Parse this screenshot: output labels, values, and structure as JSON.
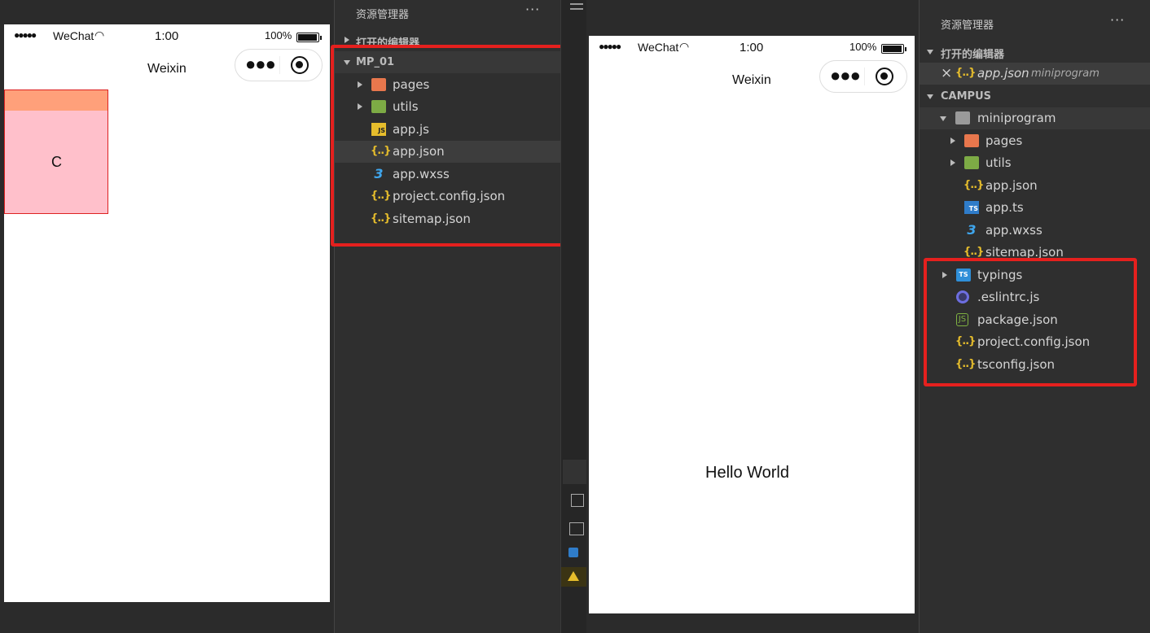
{
  "left_phone": {
    "status": {
      "carrier": "WeChat",
      "time": "1:00",
      "battery": "100%"
    },
    "nav_title": "Weixin",
    "box_text": "C"
  },
  "left_explorer": {
    "title": "资源管理器",
    "more": "···",
    "open_editors": "打开的编辑器",
    "project": "MP_01",
    "items": [
      {
        "label": "pages",
        "icon": "folder-pages-icon"
      },
      {
        "label": "utils",
        "icon": "folder-utils-icon"
      },
      {
        "label": "app.js",
        "icon": "js-file-icon"
      },
      {
        "label": "app.json",
        "icon": "json-file-icon"
      },
      {
        "label": "app.wxss",
        "icon": "css-file-icon"
      },
      {
        "label": "project.config.json",
        "icon": "json-file-icon"
      },
      {
        "label": "sitemap.json",
        "icon": "json-file-icon"
      }
    ],
    "selected": "app.json"
  },
  "right_phone": {
    "status": {
      "carrier": "WeChat",
      "time": "1:00",
      "battery": "100%"
    },
    "nav_title": "Weixin",
    "body_text": "Hello World"
  },
  "right_explorer": {
    "title": "资源管理器",
    "more": "···",
    "open_editors": "打开的编辑器",
    "open_file": {
      "close": "×",
      "name": "app.json",
      "path": "miniprogram"
    },
    "project": "CAMPUS",
    "folder": "miniprogram",
    "folder_items": [
      {
        "label": "pages",
        "icon": "folder-pages-icon"
      },
      {
        "label": "utils",
        "icon": "folder-utils-icon"
      },
      {
        "label": "app.json",
        "icon": "json-file-icon"
      },
      {
        "label": "app.ts",
        "icon": "ts-file-icon"
      },
      {
        "label": "app.wxss",
        "icon": "css-file-icon"
      },
      {
        "label": "sitemap.json",
        "icon": "json-file-icon"
      }
    ],
    "root_items": [
      {
        "label": "typings",
        "icon": "folder-typings-icon"
      },
      {
        "label": ".eslintrc.js",
        "icon": "eslint-file-icon"
      },
      {
        "label": "package.json",
        "icon": "node-file-icon"
      },
      {
        "label": "project.config.json",
        "icon": "json-file-icon"
      },
      {
        "label": "tsconfig.json",
        "icon": "json-file-icon"
      }
    ]
  },
  "colors": {
    "highlight": "#e5201e",
    "panel_bg": "#2f2f2f",
    "selected_row": "#3d3d3d"
  }
}
